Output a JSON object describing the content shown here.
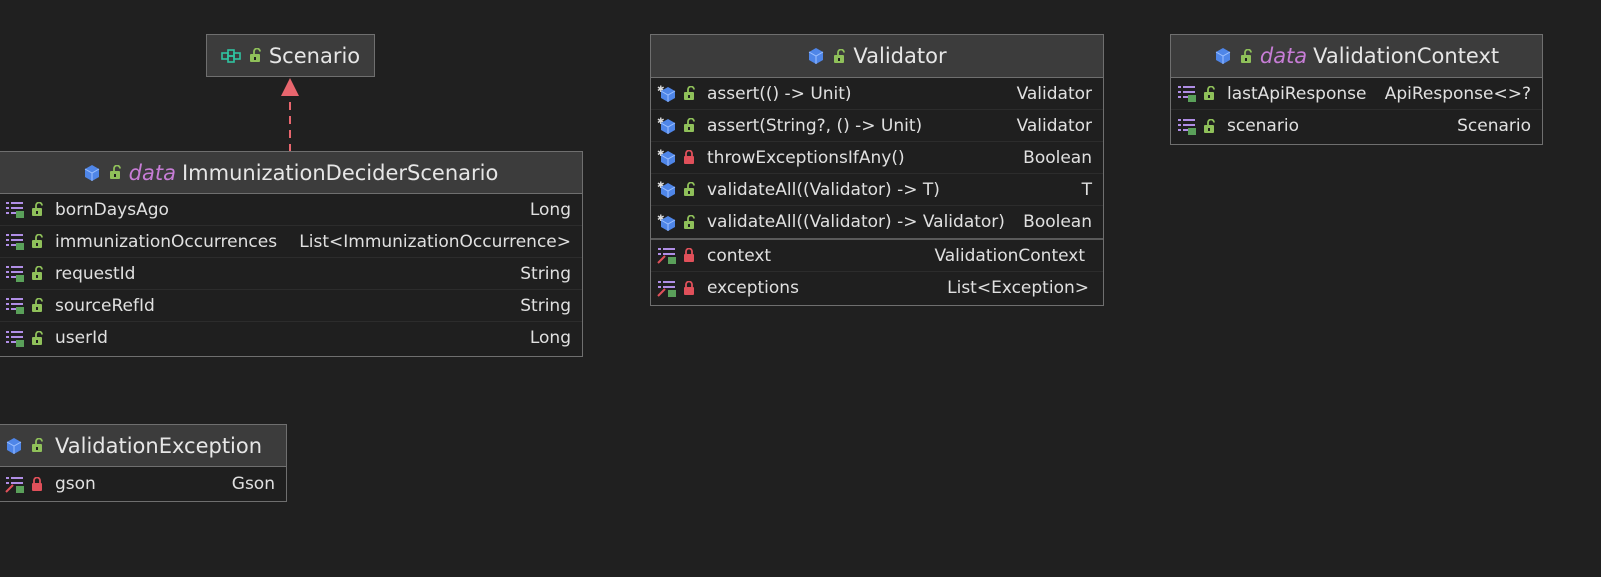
{
  "colors": {
    "background": "#202020",
    "header": "#3c3c3c",
    "border": "#6f6f6f",
    "keyword": "#c77dd6",
    "class_icon": "#4f86e8",
    "field_icon": "#b08ee6",
    "lock_open": "#8fc05a",
    "lock_closed": "#e0505a",
    "arrow": "#e8666e",
    "interface_icon": "#2fc4a0"
  },
  "diagram": {
    "scenario": {
      "title": "Scenario",
      "icons": [
        "interface-icon",
        "lock-open-icon"
      ]
    },
    "immunization": {
      "keyword": "data",
      "title": "ImmunizationDeciderScenario",
      "fields": [
        {
          "name": "bornDaysAgo",
          "type": "Long"
        },
        {
          "name": "immunizationOccurrences",
          "type": "List<ImmunizationOccurrence>"
        },
        {
          "name": "requestId",
          "type": "String"
        },
        {
          "name": "sourceRefId",
          "type": "String"
        },
        {
          "name": "userId",
          "type": "Long"
        }
      ]
    },
    "validation_exception": {
      "title": "ValidationException",
      "fields": [
        {
          "name": "gson",
          "type": "Gson"
        }
      ]
    },
    "validator": {
      "title": "Validator",
      "methods": [
        {
          "name": "assert(() -> Unit)",
          "type": "Validator",
          "visibility": "public"
        },
        {
          "name": "assert(String?, () -> Unit)",
          "type": "Validator",
          "visibility": "public"
        },
        {
          "name": "throwExceptionsIfAny()",
          "type": "Boolean",
          "visibility": "private"
        },
        {
          "name": "validateAll((Validator) -> T)",
          "type": "T",
          "visibility": "public"
        },
        {
          "name": "validateAll((Validator) -> Validator)",
          "type": "Boolean",
          "visibility": "public"
        }
      ],
      "fields": [
        {
          "name": "context",
          "type": "ValidationContext"
        },
        {
          "name": "exceptions",
          "type": "List<Exception>"
        }
      ]
    },
    "validation_context": {
      "keyword": "data",
      "title": "ValidationContext",
      "fields": [
        {
          "name": "lastApiResponse",
          "type": "ApiResponse<>?"
        },
        {
          "name": "scenario",
          "type": "Scenario"
        }
      ]
    }
  }
}
